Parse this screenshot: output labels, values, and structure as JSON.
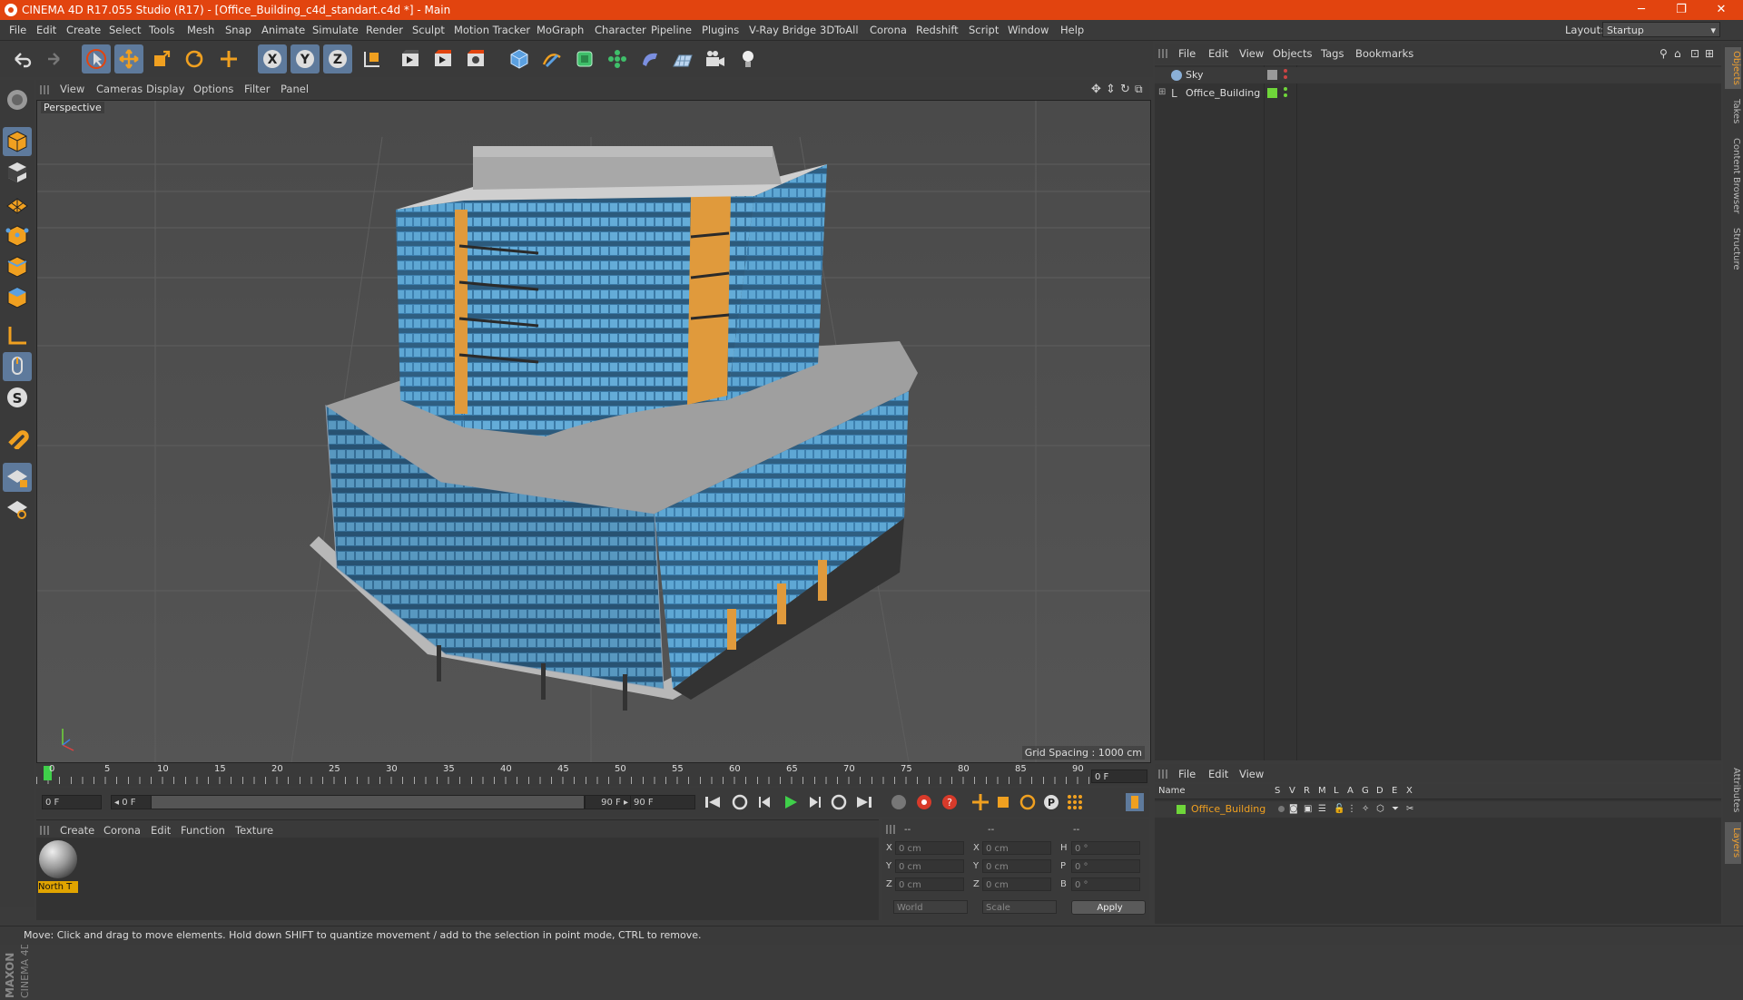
{
  "window": {
    "title": "CINEMA 4D R17.055 Studio (R17) - [Office_Building_c4d_standart.c4d *] - Main",
    "controls": {
      "minimize": "─",
      "restore": "❐",
      "close": "✕"
    }
  },
  "menubar": {
    "items": [
      "File",
      "Edit",
      "Create",
      "Select",
      "Tools",
      "Mesh",
      "Snap",
      "Animate",
      "Simulate",
      "Render",
      "Sculpt",
      "Motion Tracker",
      "MoGraph",
      "Character",
      "Pipeline",
      "Plugins",
      "V-Ray Bridge",
      "3DToAll",
      "Corona",
      "Redshift",
      "Script",
      "Window",
      "Help"
    ],
    "layout_label": "Layout:",
    "layout_value": "Startup"
  },
  "viewport": {
    "menu": [
      "View",
      "Cameras",
      "Display",
      "Options",
      "Filter",
      "Panel"
    ],
    "label": "Perspective",
    "grid_spacing": "Grid Spacing : 1000 cm"
  },
  "timeline": {
    "ticks": [
      "0",
      "5",
      "10",
      "15",
      "20",
      "25",
      "30",
      "35",
      "40",
      "45",
      "50",
      "55",
      "60",
      "65",
      "70",
      "75",
      "80",
      "85",
      "90"
    ],
    "current_frame": "0 F",
    "start_frame": "0 F",
    "range_start": "◂ 0 F",
    "range_end": "90 F ▸",
    "end_frame": "90 F"
  },
  "materials": {
    "menu": [
      "Create",
      "Corona",
      "Edit",
      "Function",
      "Texture"
    ],
    "items": [
      {
        "name": "North T"
      }
    ]
  },
  "coordinates": {
    "headers": [
      "--",
      "--",
      "--"
    ],
    "rows": [
      {
        "a_label": "X",
        "a_value": "0 cm",
        "b_label": "X",
        "b_value": "0 cm",
        "c_label": "H",
        "c_value": "0 °"
      },
      {
        "a_label": "Y",
        "a_value": "0 cm",
        "b_label": "Y",
        "b_value": "0 cm",
        "c_label": "P",
        "c_value": "0 °"
      },
      {
        "a_label": "Z",
        "a_value": "0 cm",
        "b_label": "Z",
        "b_value": "0 cm",
        "c_label": "B",
        "c_value": "0 °"
      }
    ],
    "world_select": "World",
    "scale_select": "Scale",
    "apply_label": "Apply"
  },
  "object_manager": {
    "menu": [
      "File",
      "Edit",
      "View",
      "Objects",
      "Tags",
      "Bookmarks"
    ],
    "objects": [
      {
        "name": "Sky",
        "tag_color": "#9a9a9a"
      },
      {
        "name": "Office_Building",
        "tag_color": "#6fd63a"
      }
    ]
  },
  "layer_manager": {
    "menu": [
      "File",
      "Edit",
      "View"
    ],
    "columns": [
      "Name",
      "S",
      "V",
      "R",
      "M",
      "L",
      "A",
      "G",
      "D",
      "E",
      "X"
    ],
    "layers": [
      {
        "name": "Office_Building",
        "color": "#6fd63a"
      }
    ]
  },
  "right_tabs": [
    "Objects",
    "Takes",
    "Content Browser",
    "Structure"
  ],
  "right_tabs_bottom": [
    "Attributes",
    "Layers"
  ],
  "status": "Move: Click and drag to move elements. Hold down SHIFT to quantize movement / add to the selection in point mode, CTRL to remove.",
  "branding": {
    "line1": "MAXON",
    "line2": "CINEMA 4D"
  },
  "colors": {
    "accent": "#e2440f",
    "selected_tool": "#5e7a9c",
    "material_highlight": "#e1a400"
  }
}
